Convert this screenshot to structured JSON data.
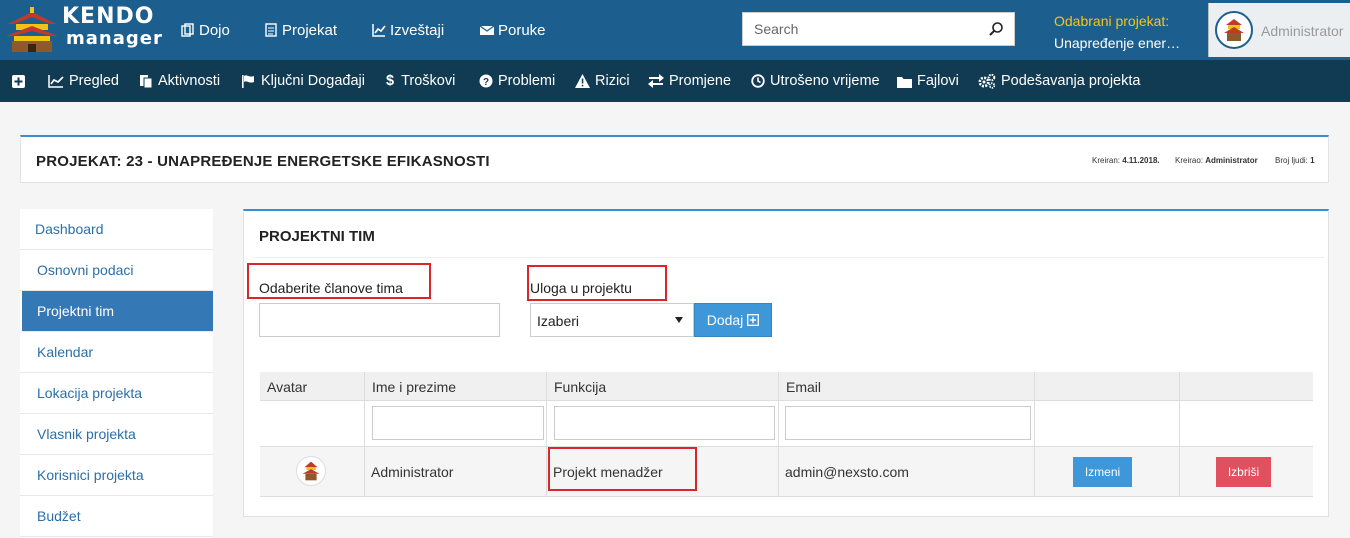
{
  "brand": {
    "line1": "KENDO",
    "line2": "manager"
  },
  "topnav": [
    {
      "label": "Dojo",
      "icon": "copy-icon"
    },
    {
      "label": "Projekat",
      "icon": "document-icon"
    },
    {
      "label": "Izveštaji",
      "icon": "line-chart-icon"
    },
    {
      "label": "Poruke",
      "icon": "envelope-icon"
    }
  ],
  "search": {
    "placeholder": "Search"
  },
  "project_selector": {
    "label": "Odabrani projekat:",
    "value": "Unapređenje ener…"
  },
  "user": {
    "name": "Administrator"
  },
  "subnav": [
    {
      "label": "",
      "icon": "plus-square-icon"
    },
    {
      "label": "Pregled",
      "icon": "line-chart-icon"
    },
    {
      "label": "Aktivnosti",
      "icon": "files-icon"
    },
    {
      "label": "Ključni Događaji",
      "icon": "flag-icon"
    },
    {
      "label": "Troškovi",
      "icon": "dollar-icon"
    },
    {
      "label": "Problemi",
      "icon": "question-circle-icon"
    },
    {
      "label": "Rizici",
      "icon": "warning-icon"
    },
    {
      "label": "Promjene",
      "icon": "exchange-icon"
    },
    {
      "label": "Utrošeno vrijeme",
      "icon": "clock-icon"
    },
    {
      "label": "Fajlovi",
      "icon": "folder-icon"
    },
    {
      "label": "Podešavanja projekta",
      "icon": "cogs-icon"
    }
  ],
  "project": {
    "title": "PROJEKAT: 23 - UNAPREĐENJE ENERGETSKE EFIKASNOSTI",
    "created_label": "Kreiran:",
    "created_value": "4.11.2018.",
    "creator_label": "Kreirao:",
    "creator_value": "Administrator",
    "people_label": "Broj ljudi:",
    "people_value": "1"
  },
  "sidebar": [
    {
      "label": "Dashboard",
      "active": false
    },
    {
      "label": "Osnovni podaci",
      "active": false
    },
    {
      "label": "Projektni tim",
      "active": true
    },
    {
      "label": "Kalendar",
      "active": false
    },
    {
      "label": "Lokacija projekta",
      "active": false
    },
    {
      "label": "Vlasnik projekta",
      "active": false
    },
    {
      "label": "Korisnici projekta",
      "active": false
    },
    {
      "label": "Budžet",
      "active": false
    }
  ],
  "team_panel": {
    "title": "PROJEKTNI TIM",
    "members_label": "Odaberite članove tima",
    "members_value": "",
    "role_label": "Uloga u projektu",
    "role_selected": "Izaberi",
    "add_button": "Dodaj"
  },
  "table": {
    "columns": [
      "Avatar",
      "Ime i prezime",
      "Funkcija",
      "Email",
      "",
      ""
    ],
    "filters": {
      "name": "",
      "function": "",
      "email": ""
    },
    "rows": [
      {
        "name": "Administrator",
        "function": "Projekt menadžer",
        "email": "admin@nexsto.com",
        "edit": "Izmeni",
        "delete": "Izbriši"
      }
    ]
  },
  "colors": {
    "topbar": "#1c5f8e",
    "subbar": "#113b52",
    "accent": "#3d97d8",
    "danger": "#e0505e",
    "highlight": "#d9262b",
    "label_yellow": "#f5c518"
  }
}
